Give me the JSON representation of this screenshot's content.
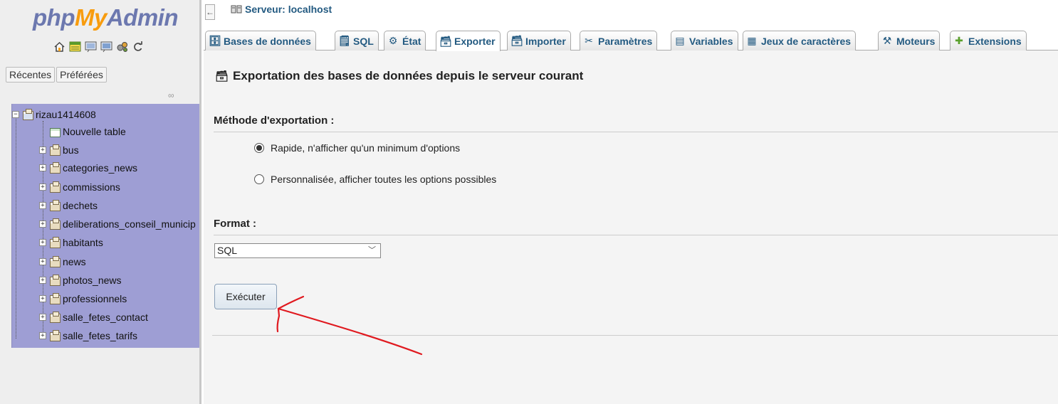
{
  "nav": {
    "logo": {
      "php": "php",
      "my": "My",
      "admin": "Admin"
    },
    "icons": [
      "home-icon",
      "sql-icon",
      "docs-icon",
      "docs-alt-icon",
      "settings-icon",
      "reload-icon"
    ],
    "recent_label": "Récentes",
    "favorites_label": "Préférées",
    "tree": {
      "database": "rizau1414608",
      "new_table": "Nouvelle table",
      "tables": [
        "bus",
        "categories_news",
        "commissions",
        "dechets",
        "deliberations_conseil_municip",
        "habitants",
        "news",
        "photos_news",
        "professionnels",
        "salle_fetes_contact",
        "salle_fetes_tarifs"
      ]
    }
  },
  "topbar": {
    "server": "Serveur: localhost"
  },
  "tabs": [
    {
      "label": "Bases de données",
      "icon": "database-icon"
    },
    {
      "label": "SQL",
      "icon": "sql-icon"
    },
    {
      "label": "État",
      "icon": "status-icon"
    },
    {
      "label": "Exporter",
      "icon": "export-icon",
      "active": true
    },
    {
      "label": "Importer",
      "icon": "import-icon"
    },
    {
      "label": "Paramètres",
      "icon": "settings-icon"
    },
    {
      "label": "Variables",
      "icon": "variables-icon"
    },
    {
      "label": "Jeux de caractères",
      "icon": "charset-icon"
    },
    {
      "label": "Moteurs",
      "icon": "engines-icon"
    },
    {
      "label": "Extensions",
      "icon": "extensions-icon"
    }
  ],
  "main": {
    "title": "Exportation des bases de données depuis le serveur courant",
    "method_heading": "Méthode d'exportation :",
    "method_quick": "Rapide, n'afficher qu'un minimum d'options",
    "method_custom": "Personnalisée, afficher toutes les options possibles",
    "selected_method": "quick",
    "format_heading": "Format :",
    "format_value": "SQL",
    "execute_label": "Exécuter"
  },
  "colors": {
    "tab_text": "#235a81",
    "tree_bg": "#9e9ed4",
    "annotation": "#e0191f"
  }
}
